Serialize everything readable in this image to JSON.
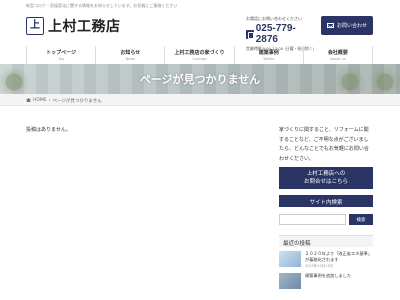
{
  "header": {
    "notice": "新型コロナ・気候変化に関する情報をお知らせしています。お気軽にご連絡ください",
    "logo_mark": "上",
    "logo_text": "上村工務店",
    "contact_small": "お電話にお問い合わせください",
    "phone": "025-779-2876",
    "hours": "営業時間 8:00-17:00 (日曜・祝日除く)",
    "inquiry_label": "お問い合わせ"
  },
  "nav": [
    {
      "label": "トップページ",
      "sub": "Top"
    },
    {
      "label": "お知らせ",
      "sub": "News"
    },
    {
      "label": "上村工務店の家づくり",
      "sub": "Concept"
    },
    {
      "label": "建築事例",
      "sub": "Works"
    },
    {
      "label": "会社概要",
      "sub": "About us"
    }
  ],
  "hero": {
    "title": "ページが見つかりません"
  },
  "breadcrumb": {
    "home": "HOME",
    "current": "ページが見つかりません"
  },
  "main": {
    "no_posts": "投稿はありません。"
  },
  "sidebar": {
    "intro": "家づくりに関すること、リフォームに関することなど、ご不明な点がございましたら、どんなことでもお気軽にお問い合わせください。",
    "cta_line1": "上村工務店への",
    "cta_line2": "お問合せはこちら",
    "search_heading": "サイト内検索",
    "search_placeholder": "",
    "search_button": "検索",
    "latest_heading": "最近の投稿",
    "posts": [
      {
        "title": "２０２０年より「改正省エネ基準」が義務化されます",
        "date": "2019年10月15日"
      },
      {
        "title": "建築事例を追加しました",
        "date": ""
      }
    ]
  },
  "colors": {
    "brand": "#2a3566"
  }
}
